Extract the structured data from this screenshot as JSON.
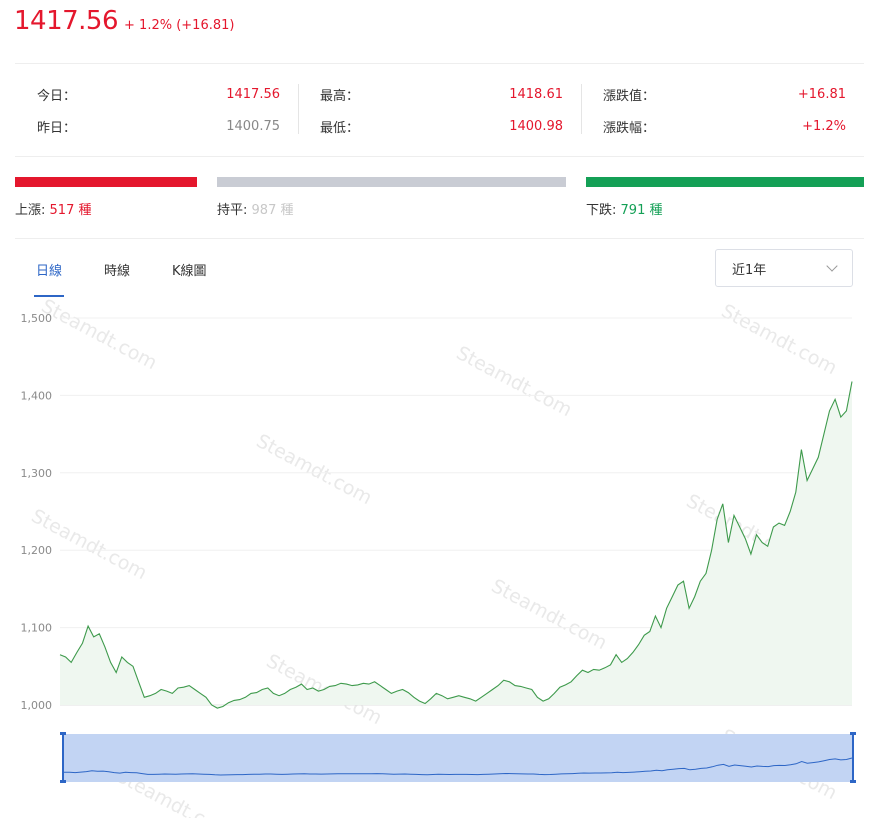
{
  "header": {
    "price": "1417.56",
    "change": "+ 1.2% (+16.81)"
  },
  "stats": {
    "columns": [
      {
        "rows": [
          {
            "label": "今日：",
            "value": "1417.56"
          },
          {
            "label": "昨日：",
            "value": "1400.75"
          }
        ]
      },
      {
        "rows": [
          {
            "label": "最高：",
            "value": "1418.61"
          },
          {
            "label": "最低：",
            "value": "1400.98"
          }
        ]
      },
      {
        "rows": [
          {
            "label": "漲跌值：",
            "value": "+16.81"
          },
          {
            "label": "漲跌幅：",
            "value": "+1.2%"
          }
        ]
      }
    ]
  },
  "breadth": {
    "up": {
      "label": "上漲:",
      "count": "517 種",
      "color": "#e4172d"
    },
    "flat": {
      "label": "持平:",
      "count": "987 種",
      "color": "#c9ccd4"
    },
    "down": {
      "label": "下跌:",
      "count": "791 種",
      "color": "#14a056"
    }
  },
  "tabs": [
    {
      "label": "日線",
      "active": true
    },
    {
      "label": "時線",
      "active": false
    },
    {
      "label": "K線圖",
      "active": false
    }
  ],
  "range_select": {
    "value": "近1年"
  },
  "watermark": "Steamdt.com",
  "chart_data": {
    "type": "area",
    "title": "",
    "xlabel": "",
    "ylabel": "",
    "ylim": [
      1000,
      1500
    ],
    "yticks": [
      "1,000",
      "1,100",
      "1,200",
      "1,300",
      "1,400",
      "1,500"
    ],
    "grid": true,
    "line_color": "#3e9a4c",
    "fill_color": "#eff7f0",
    "values": [
      1065,
      1062,
      1055,
      1068,
      1080,
      1102,
      1088,
      1092,
      1075,
      1055,
      1042,
      1062,
      1055,
      1050,
      1030,
      1010,
      1012,
      1015,
      1020,
      1018,
      1015,
      1022,
      1023,
      1025,
      1020,
      1015,
      1010,
      1000,
      996,
      998,
      1003,
      1006,
      1007,
      1010,
      1015,
      1016,
      1020,
      1022,
      1015,
      1012,
      1015,
      1020,
      1023,
      1027,
      1020,
      1022,
      1018,
      1020,
      1024,
      1025,
      1028,
      1027,
      1025,
      1026,
      1028,
      1027,
      1030,
      1025,
      1020,
      1015,
      1018,
      1020,
      1016,
      1010,
      1005,
      1002,
      1008,
      1015,
      1012,
      1008,
      1010,
      1012,
      1010,
      1008,
      1005,
      1010,
      1015,
      1020,
      1025,
      1032,
      1030,
      1025,
      1024,
      1022,
      1020,
      1010,
      1005,
      1008,
      1015,
      1023,
      1026,
      1030,
      1038,
      1045,
      1042,
      1046,
      1045,
      1048,
      1052,
      1065,
      1055,
      1060,
      1068,
      1078,
      1090,
      1095,
      1115,
      1100,
      1125,
      1140,
      1155,
      1160,
      1125,
      1140,
      1160,
      1170,
      1200,
      1240,
      1260,
      1210,
      1245,
      1230,
      1215,
      1195,
      1220,
      1210,
      1205,
      1230,
      1235,
      1232,
      1250,
      1275,
      1330,
      1290,
      1305,
      1320,
      1350,
      1380,
      1395,
      1372,
      1380,
      1418
    ]
  }
}
